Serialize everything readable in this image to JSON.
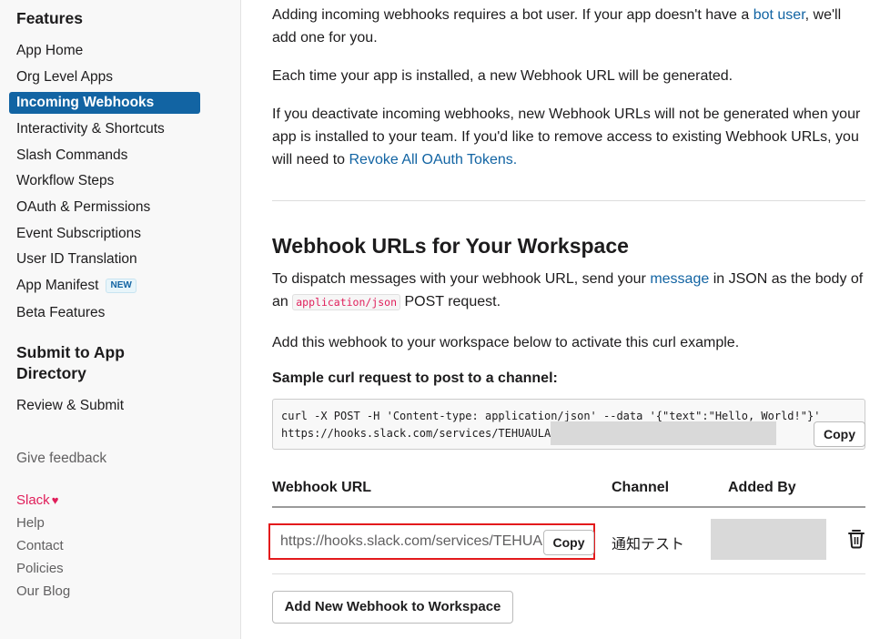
{
  "sidebar": {
    "features_heading": "Features",
    "items": [
      {
        "label": "App Home"
      },
      {
        "label": "Org Level Apps"
      },
      {
        "label": "Incoming Webhooks",
        "active": true
      },
      {
        "label": "Interactivity & Shortcuts"
      },
      {
        "label": "Slash Commands"
      },
      {
        "label": "Workflow Steps"
      },
      {
        "label": "OAuth & Permissions"
      },
      {
        "label": "Event Subscriptions"
      },
      {
        "label": "User ID Translation"
      },
      {
        "label": "App Manifest",
        "badge": "NEW"
      },
      {
        "label": "Beta Features"
      }
    ],
    "submit_heading_line1": "Submit to App",
    "submit_heading_line2": "Directory",
    "review_submit": "Review & Submit",
    "give_feedback": "Give feedback",
    "footer": {
      "slack": "Slack",
      "heart": "♥",
      "help": "Help",
      "contact": "Contact",
      "policies": "Policies",
      "blog": "Our Blog"
    }
  },
  "main": {
    "intro": {
      "p1_text": "Adding incoming webhooks requires a bot user. If your app doesn't have a ",
      "p1_link": "bot user",
      "p1_end": ", we'll add one for you.",
      "p2": "Each time your app is installed, a new Webhook URL will be generated.",
      "p3_text": "If you deactivate incoming webhooks, new Webhook URLs will not be generated when your app is installed to your team. If you'd like to remove access to existing Webhook URLs, you will need to ",
      "p3_link": "Revoke All OAuth Tokens."
    },
    "section_title": "Webhook URLs for Your Workspace",
    "dispatch": {
      "text1": "To dispatch messages with your webhook URL, send your ",
      "link": "message",
      "text2": " in JSON as the body of an ",
      "code": "application/json",
      "text3": " POST request."
    },
    "activate_text": "Add this webhook to your workspace below to activate this curl example.",
    "sample_label": "Sample curl request to post to a channel:",
    "curl_line1": "curl -X POST -H 'Content-type: application/json' --data '{\"text\":\"Hello, World!\"}'",
    "curl_line2": "https://hooks.slack.com/services/TEHUAULAU/",
    "copy_label": "Copy",
    "table": {
      "col_url": "Webhook URL",
      "col_channel": "Channel",
      "col_added_by": "Added By",
      "row": {
        "url": "https://hooks.slack.com/services/TEHUAULAU/",
        "copy": "Copy",
        "channel": "通知テスト",
        "delete_icon": "trash-icon"
      }
    },
    "add_button": "Add New Webhook to Workspace"
  },
  "colors": {
    "accent": "#1264a3",
    "highlight_border": "#e31a1c",
    "slack_pink": "#e01e5a"
  }
}
